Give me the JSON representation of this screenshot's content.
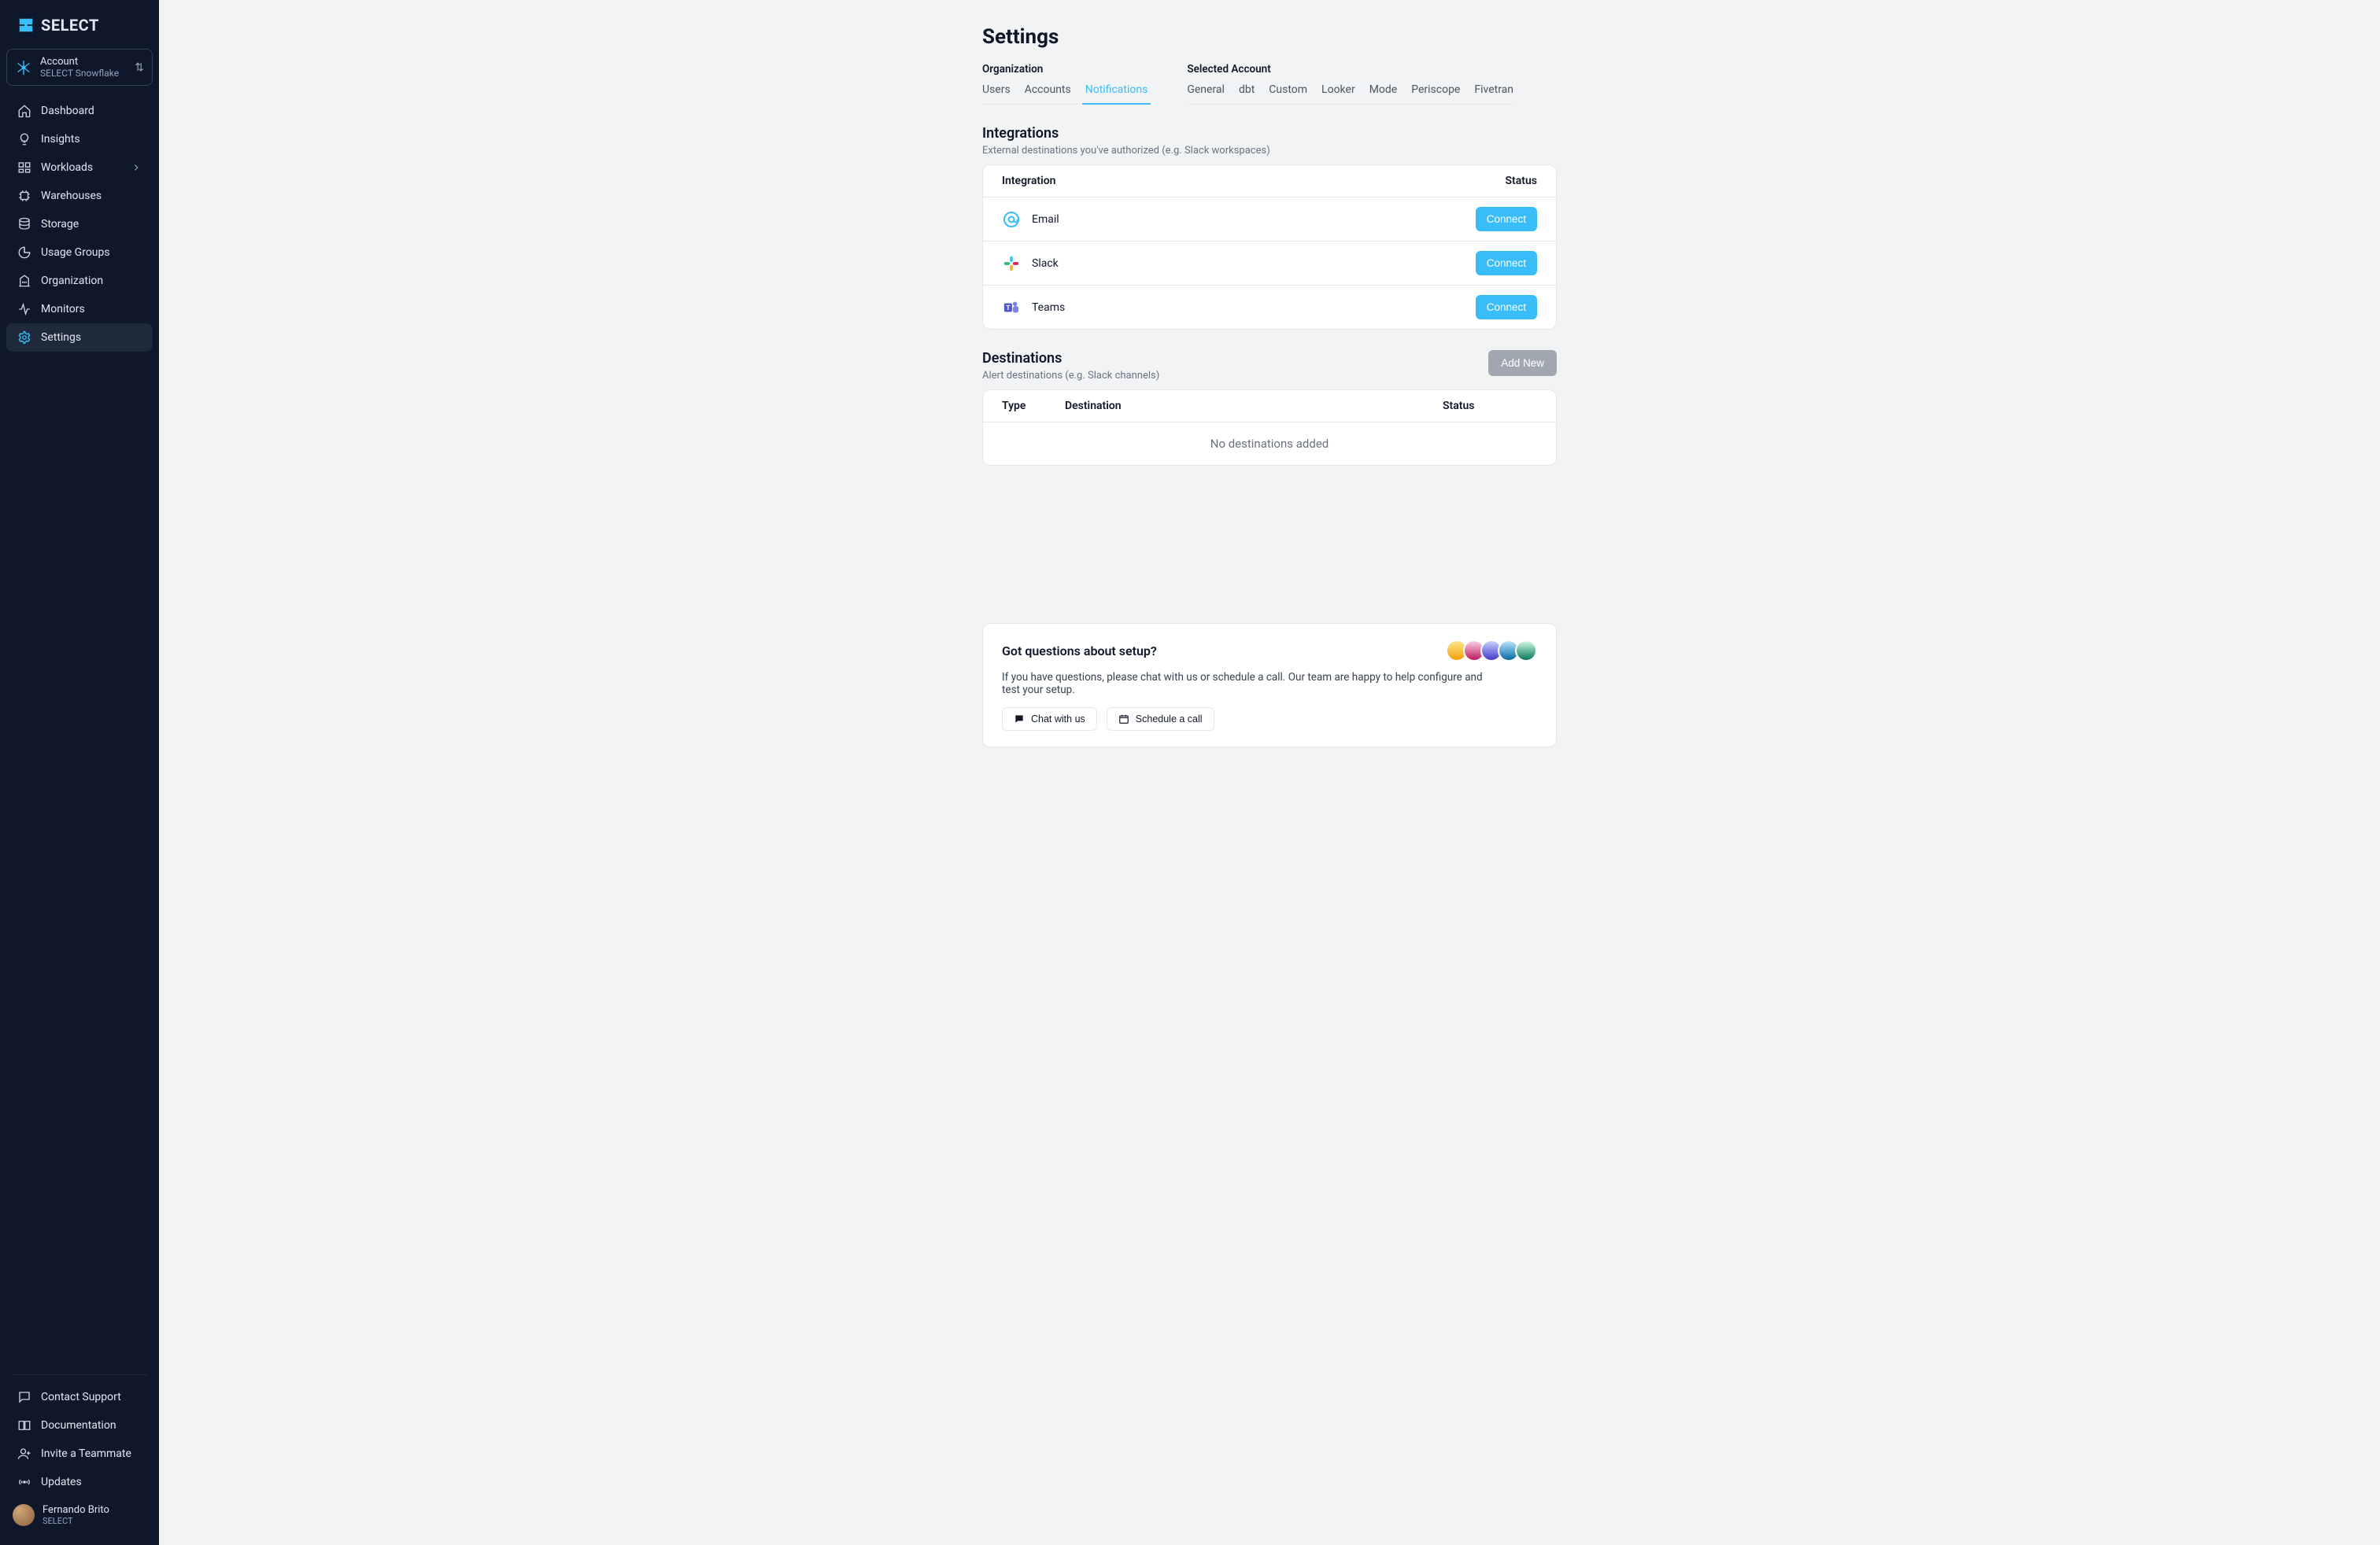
{
  "brand": "SELECT",
  "account_switcher": {
    "label": "Account",
    "name": "SELECT Snowflake"
  },
  "sidebar": {
    "items": [
      {
        "label": "Dashboard"
      },
      {
        "label": "Insights"
      },
      {
        "label": "Workloads"
      },
      {
        "label": "Warehouses"
      },
      {
        "label": "Storage"
      },
      {
        "label": "Usage Groups"
      },
      {
        "label": "Organization"
      },
      {
        "label": "Monitors"
      },
      {
        "label": "Settings"
      }
    ],
    "bottom": [
      {
        "label": "Contact Support"
      },
      {
        "label": "Documentation"
      },
      {
        "label": "Invite a Teammate"
      },
      {
        "label": "Updates"
      }
    ]
  },
  "user": {
    "name": "Fernando Brito",
    "org": "SELECT"
  },
  "page": {
    "title": "Settings"
  },
  "tabgroups": {
    "org": {
      "label": "Organization",
      "tabs": [
        "Users",
        "Accounts",
        "Notifications"
      ],
      "active": "Notifications"
    },
    "account": {
      "label": "Selected Account",
      "tabs": [
        "General",
        "dbt",
        "Custom",
        "Looker",
        "Mode",
        "Periscope",
        "Fivetran"
      ]
    }
  },
  "integrations": {
    "title": "Integrations",
    "subtitle": "External destinations you've authorized (e.g. Slack workspaces)",
    "headers": {
      "name": "Integration",
      "status": "Status"
    },
    "rows": [
      {
        "name": "Email",
        "action": "Connect"
      },
      {
        "name": "Slack",
        "action": "Connect"
      },
      {
        "name": "Teams",
        "action": "Connect"
      }
    ]
  },
  "destinations": {
    "title": "Destinations",
    "subtitle": "Alert destinations (e.g. Slack channels)",
    "add_label": "Add New",
    "headers": {
      "type": "Type",
      "dest": "Destination",
      "status": "Status"
    },
    "empty": "No destinations added"
  },
  "help": {
    "title": "Got questions about setup?",
    "body": "If you have questions, please chat with us or schedule a call. Our team are happy to help configure and test your setup.",
    "chat": "Chat with us",
    "schedule": "Schedule a call"
  }
}
